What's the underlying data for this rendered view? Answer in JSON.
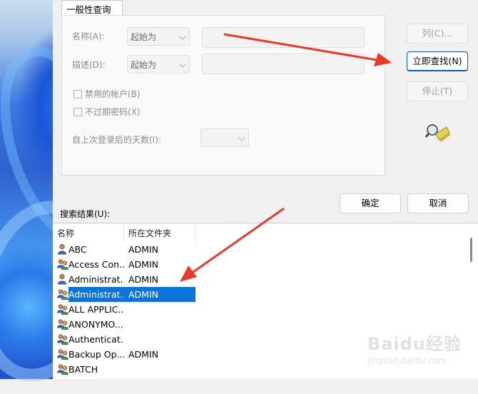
{
  "tab": {
    "label": "一般性查询"
  },
  "query": {
    "name_label": "名称(A):",
    "name_mode": "起始为",
    "name_value": "",
    "desc_label": "描述(D):",
    "desc_mode": "起始为",
    "desc_value": "",
    "disabled_accounts": "禁用的帐户(B)",
    "non_expiring_pw": "不过期密码(X)",
    "days_since_logon_label": "自上次登录后的天数(I):",
    "days_since_logon_value": ""
  },
  "buttons": {
    "columns": "列(C)...",
    "find_now": "立即查找(N)",
    "stop": "停止(T)",
    "ok": "确定",
    "cancel": "取消"
  },
  "results": {
    "label": "搜索结果(U):",
    "columns": [
      "名称",
      "所在文件夹"
    ],
    "rows": [
      {
        "name": "ABC",
        "folder": "ADMIN",
        "icon": "user-icon",
        "selected": false
      },
      {
        "name": "Access Con...",
        "folder": "ADMIN",
        "icon": "group-icon",
        "selected": false
      },
      {
        "name": "Administrat...",
        "folder": "ADMIN",
        "icon": "user-icon",
        "selected": false
      },
      {
        "name": "Administrat...",
        "folder": "ADMIN",
        "icon": "group-icon",
        "selected": true
      },
      {
        "name": "ALL APPLIC...",
        "folder": "",
        "icon": "group-icon",
        "selected": false
      },
      {
        "name": "ANONYMO...",
        "folder": "",
        "icon": "group-icon",
        "selected": false
      },
      {
        "name": "Authenticat...",
        "folder": "",
        "icon": "group-icon",
        "selected": false
      },
      {
        "name": "Backup Op...",
        "folder": "ADMIN",
        "icon": "group-icon",
        "selected": false
      },
      {
        "name": "BATCH",
        "folder": "",
        "icon": "group-icon",
        "selected": false
      }
    ]
  },
  "watermark": {
    "brand": "Baidu经验",
    "url": "jingyan.baidu.com"
  },
  "colors": {
    "selection": "#0a74d8",
    "arrow": "#e8392a",
    "primary_border": "#0b5cad"
  }
}
